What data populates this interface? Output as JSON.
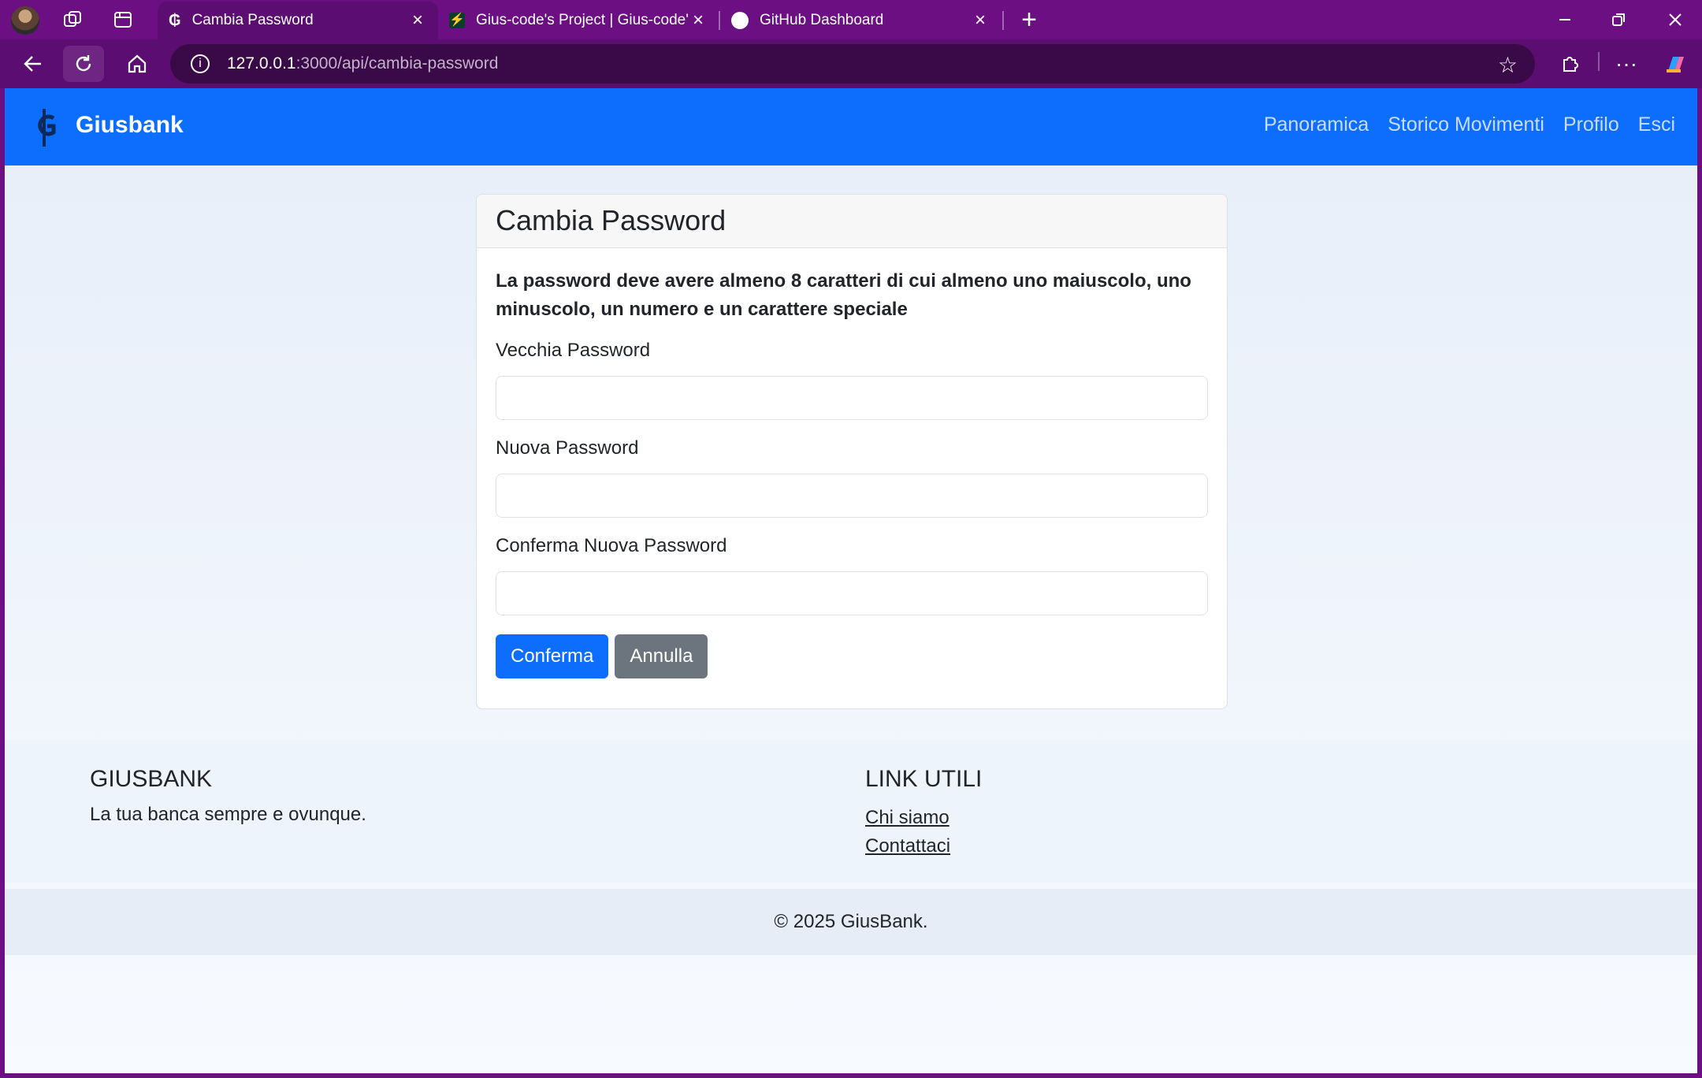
{
  "browser": {
    "tabs": [
      {
        "title": "Cambia Password",
        "active": true
      },
      {
        "title": "Gius-code's Project | Gius-code's",
        "active": false
      },
      {
        "title": "GitHub Dashboard",
        "active": false
      }
    ],
    "url_host": "127.0.0.1",
    "url_path": ":3000/api/cambia-password",
    "accent_color": "#6b0f82"
  },
  "navbar": {
    "brand": "Giusbank",
    "links": [
      "Panoramica",
      "Storico Movimenti",
      "Profilo",
      "Esci"
    ],
    "background": "#0d6efd"
  },
  "form": {
    "title": "Cambia Password",
    "hint": "La password deve avere almeno 8 caratteri di cui almeno uno maiuscolo, uno minuscolo, un numero e un carattere speciale",
    "fields": [
      {
        "label": "Vecchia Password",
        "value": ""
      },
      {
        "label": "Nuova Password",
        "value": ""
      },
      {
        "label": "Conferma Nuova Password",
        "value": ""
      }
    ],
    "confirm_label": "Conferma",
    "cancel_label": "Annulla"
  },
  "footer": {
    "about_title": "GIUSBANK",
    "about_text": "La tua banca sempre e ovunque.",
    "links_title": "LINK UTILI",
    "links": [
      "Chi siamo",
      "Contattaci"
    ],
    "copyright": "© 2025 GiusBank."
  }
}
